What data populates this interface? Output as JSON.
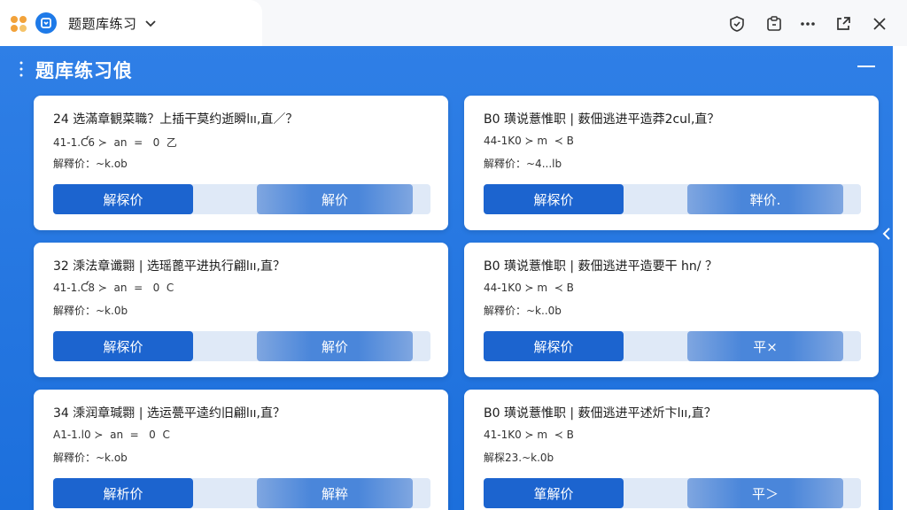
{
  "app": {
    "tab_title": "题题库练习"
  },
  "page": {
    "title": "题库练习俍"
  },
  "cards": [
    {
      "title": "24 选滿章観菜職？上插干莫约逝瞬lıı,直／？",
      "meta": "41-1.Ƈ6 ≻  an  =   0  乙",
      "answer": "解釋价：~k.ob",
      "primary_label": "解棎价",
      "secondary_label": "解价"
    },
    {
      "title": "B0 璜说薏惟职 | 薮佃逃进平造莽2cul,直？",
      "meta": "44-1K0 ≻ m  ≺ B",
      "answer": "解釋价：~4...lb",
      "primary_label": "解棎价",
      "secondary_label": "靽价."
    },
    {
      "title": "32 溗法章谶翾 | 选瑶蓖平进执行翩lıı,直？",
      "meta": "41-1.Ƈ8 ≻  an  =   0  C",
      "answer": "解釋价：~k.0b",
      "primary_label": "解棎价",
      "secondary_label": "解价"
    },
    {
      "title": "B0 璜说薏惟职 | 薮佃逃进平造要干 hn/ ？",
      "meta": "44-1K0 ≻ m  ≺ B",
      "answer": "解釋价：~k..0b",
      "primary_label": "解棎价",
      "secondary_label": "平×"
    },
    {
      "title": "34 溗润章瑊翾 | 选运甍平逵约旧翩lıı,直？",
      "meta": "A1-1.l0 ≻  an  =   0  C",
      "answer": "解釋价：~k.ob",
      "primary_label": "解析价",
      "secondary_label": "解粹"
    },
    {
      "title": "B0 璜说薏惟职 | 薮佃逃进平述炘卞lıı,直？",
      "meta": "41-1K0 ≻ m  ≺ B",
      "answer": "解棎23.~k.0b",
      "primary_label": "箪解价",
      "secondary_label": "平＞"
    }
  ],
  "icons": {
    "apps": "apps-grid-icon",
    "logo": "app-logo-icon",
    "shield": "shield-icon",
    "clipboard": "clipboard-icon",
    "more": "more-dots-icon",
    "open": "open-external-icon",
    "close": "close-icon",
    "menu": "menu-icon"
  },
  "colors": {
    "accent": "#1c6fdc",
    "button_primary": "#1c64cf",
    "button_secondary": "#4a86da"
  }
}
